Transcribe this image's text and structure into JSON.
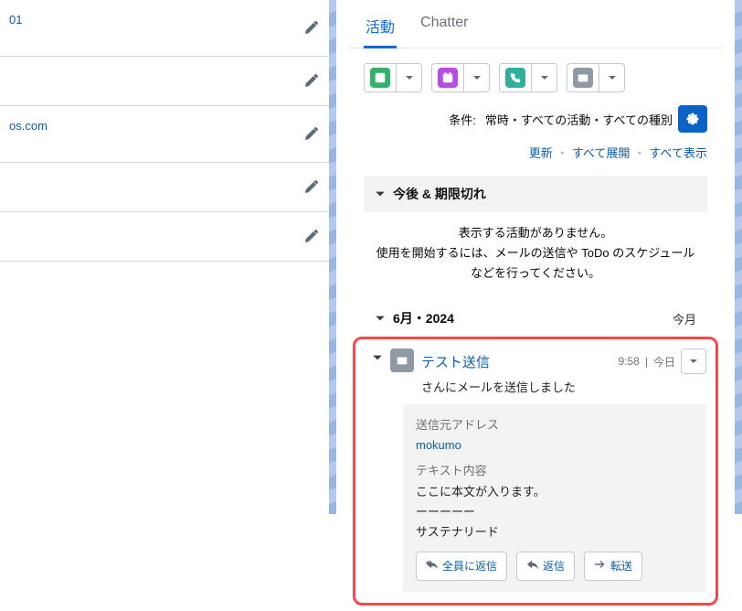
{
  "left_fields": {
    "f1": "01",
    "f2": "os.com"
  },
  "tabs": {
    "activity": "活動",
    "chatter": "Chatter"
  },
  "filter": {
    "prefix": "条件:",
    "value": "常時・すべての活動・すべての種別"
  },
  "links": {
    "refresh": "更新",
    "expand_all": "すべて展開",
    "show_all": "すべて表示"
  },
  "upcoming": {
    "title": "今後 & 期限切れ",
    "empty1": "表示する活動がありません。",
    "empty2": "使用を開始するには、メールの送信や ToDo のスケジュールなどを行ってください。"
  },
  "month": {
    "label": "6月・2024",
    "badge": "今月"
  },
  "item": {
    "title": "テスト送信",
    "time": "9:58",
    "day": "今日",
    "subtitle": "さんにメールを送信しました",
    "from_label": "送信元アドレス",
    "from_value": "mokumo",
    "text_label": "テキスト内容",
    "text_body": "ここに本文が入ります。",
    "text_sep": "ーーーーー",
    "text_tail": "サステナリード",
    "reply_all": "全員に返信",
    "reply": "返信",
    "forward": "転送"
  }
}
